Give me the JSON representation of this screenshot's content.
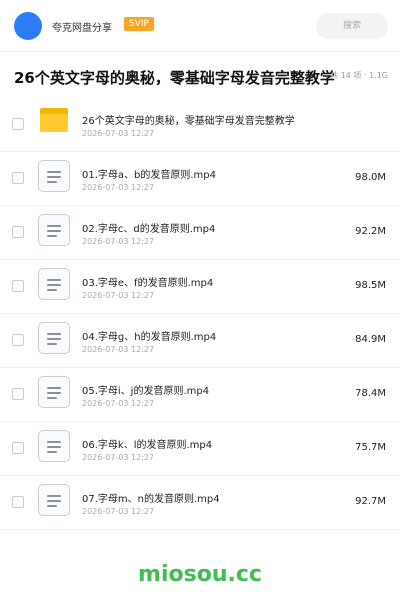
{
  "header": {
    "brand": "夸克网盘分享",
    "badge": "SVIP",
    "search_placeholder": "搜索"
  },
  "title": "26个英文字母的奥秘，零基础字母发音完整教学",
  "meta": "共 14 项 · 1.1G",
  "folder": {
    "name": "26个英文字母的奥秘，零基础字母发音完整教学",
    "date": "2026-07-03 12:27"
  },
  "files": [
    {
      "name": "01.字母a、b的发音原则.mp4",
      "date": "2026-07-03 12:27",
      "size": "98.0M"
    },
    {
      "name": "02.字母c、d的发音原则.mp4",
      "date": "2026-07-03 12:27",
      "size": "92.2M"
    },
    {
      "name": "03.字母e、f的发音原则.mp4",
      "date": "2026-07-03 12:27",
      "size": "98.5M"
    },
    {
      "name": "04.字母g、h的发音原则.mp4",
      "date": "2026-07-03 12:27",
      "size": "84.9M"
    },
    {
      "name": "05.字母i、j的发音原则.mp4",
      "date": "2026-07-03 12:27",
      "size": "78.4M"
    },
    {
      "name": "06.字母k、l的发音原则.mp4",
      "date": "2026-07-03 12:27",
      "size": "75.7M"
    },
    {
      "name": "07.字母m、n的发音原则.mp4",
      "date": "2026-07-03 12:27",
      "size": "92.7M"
    }
  ],
  "watermark": "miosou.cc",
  "colors": {
    "avatar": "#2b7cf6",
    "badge": "#f5a623",
    "folder": "#ffcb2e",
    "watermark": "#3ebd52"
  },
  "icons": {
    "folder": "folder-icon",
    "file": "video-file-icon",
    "checkbox": "checkbox"
  }
}
